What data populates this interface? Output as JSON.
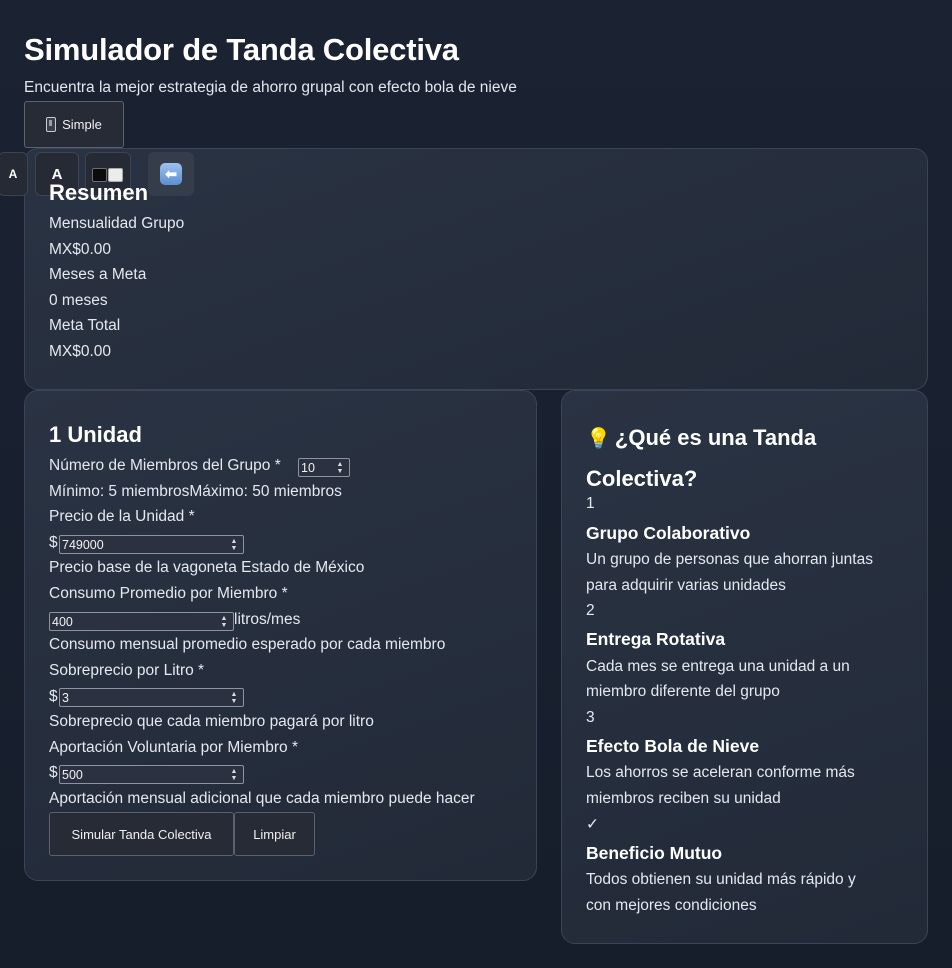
{
  "header": {
    "title": "Simulador de Tanda Colectiva",
    "subtitle": "Encuentra la mejor estrategia de ahorro grupal con efecto bola de nieve",
    "mode_button": {
      "label": "Simple",
      "icon": "mobile-phone-icon"
    }
  },
  "toolbar": {
    "font_small_label": "A",
    "font_large_label": "A",
    "contrast_icon": "contrast-icon",
    "back_icon": "left-arrow-icon",
    "back_symbol": "⬅"
  },
  "resumen": {
    "title": "Resumen",
    "rows": [
      "Mensualidad Grupo",
      "MX$0.00",
      "Meses a Meta",
      "0 meses",
      "Meta Total",
      "MX$0.00"
    ]
  },
  "form": {
    "title": "1 Unidad",
    "members_label": "Número de Miembros del Grupo *",
    "members_value": "10",
    "members_range": "Mínimo: 5 miembrosMáximo: 50 miembros",
    "price_label": "Precio de la Unidad *",
    "currency_symbol": "$",
    "price_value": "749000",
    "price_hint": "Precio base de la vagoneta Estado de México",
    "consumption_label": "Consumo Promedio por Miembro *",
    "consumption_value": "400",
    "consumption_unit": "litros/mes",
    "consumption_hint": "Consumo mensual promedio esperado por cada miembro",
    "surcharge_label": "Sobreprecio por Litro *",
    "surcharge_value": "3",
    "surcharge_hint": "Sobreprecio que cada miembro pagará por litro",
    "voluntary_label": "Aportación Voluntaria por Miembro *",
    "voluntary_value": "500",
    "voluntary_hint": "Aportación mensual adicional que cada miembro puede hacer",
    "simulate_button": "Simular Tanda Colectiva",
    "clear_button": "Limpiar"
  },
  "info": {
    "icon": "lightbulb-icon",
    "title": "¿Qué es una Tanda Colectiva?",
    "steps": [
      {
        "marker": "1",
        "heading": "Grupo Colaborativo",
        "text": [
          "Un grupo de personas que ahorran juntas",
          "para adquirir varias unidades"
        ]
      },
      {
        "marker": "2",
        "heading": "Entrega Rotativa",
        "text": [
          "Cada mes se entrega una unidad a un",
          "miembro diferente del grupo"
        ]
      },
      {
        "marker": "3",
        "heading": "Efecto Bola de Nieve",
        "text": [
          "Los ahorros se aceleran conforme más",
          "miembros reciben su unidad"
        ]
      },
      {
        "marker": "✓",
        "heading": "Beneficio Mutuo",
        "text": [
          "Todos obtienen su unidad más rápido y",
          "con mejores condiciones"
        ]
      }
    ]
  }
}
